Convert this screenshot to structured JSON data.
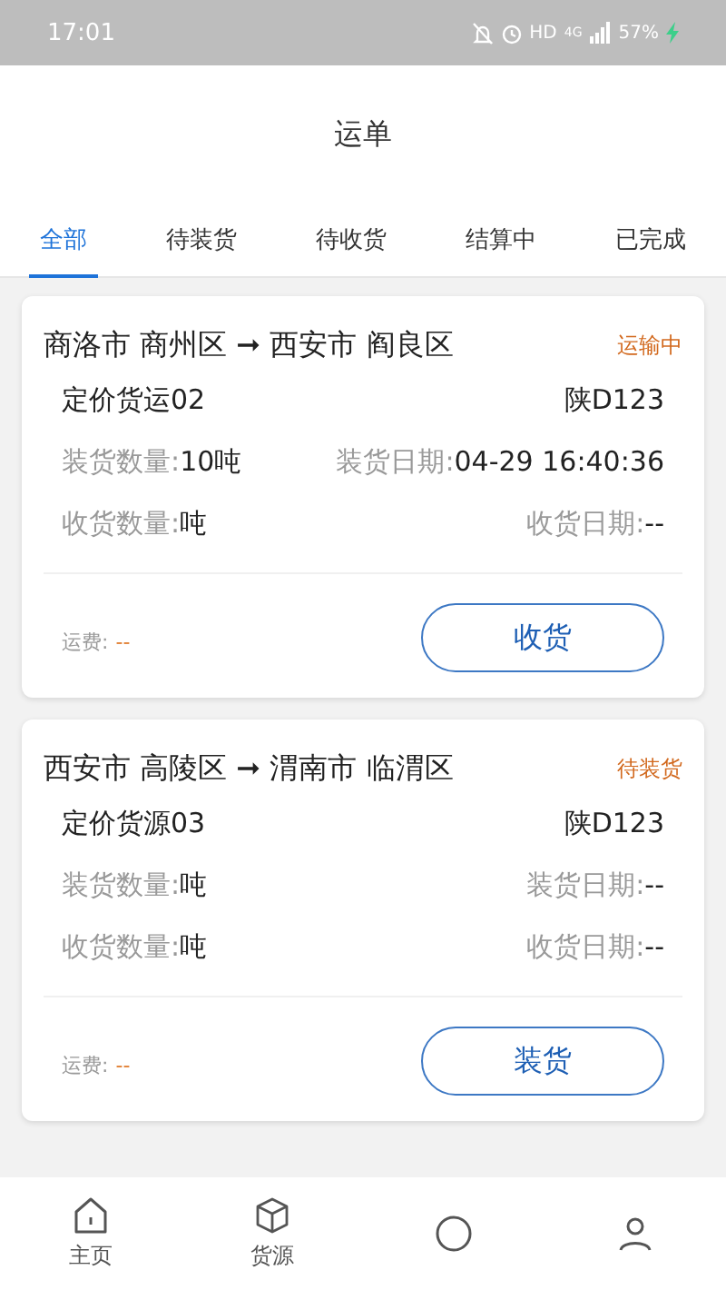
{
  "status_bar": {
    "time": "17:01",
    "hd": "HD",
    "network": "4G",
    "battery": "57%",
    "charging": true
  },
  "title": "运单",
  "tabs": [
    {
      "label": "全部",
      "selected": true
    },
    {
      "label": "待装货",
      "selected": false
    },
    {
      "label": "待收货",
      "selected": false
    },
    {
      "label": "结算中",
      "selected": false
    },
    {
      "label": "已完成",
      "selected": false
    }
  ],
  "orders": [
    {
      "route": "商洛市 商州区 ➞ 西安市 阎良区",
      "status": "运输中",
      "name": "定价货运02",
      "plate": "陕D123",
      "load_qty": {
        "label": "装货数量:",
        "value": "10吨"
      },
      "load_date": {
        "label": "装货日期:",
        "value": "04-29 16:40:36"
      },
      "recv_qty": {
        "label": "收货数量:",
        "value": "吨"
      },
      "recv_date": {
        "label": "收货日期:",
        "value": "--"
      },
      "fee": {
        "label": "运费:",
        "value": "--"
      },
      "action": "收货"
    },
    {
      "route": "西安市 高陵区 ➞ 渭南市 临渭区",
      "status": "待装货",
      "name": "定价货源03",
      "plate": "陕D123",
      "load_qty": {
        "label": "装货数量:",
        "value": "吨"
      },
      "load_date": {
        "label": "装货日期:",
        "value": "--"
      },
      "recv_qty": {
        "label": "收货数量:",
        "value": "吨"
      },
      "recv_date": {
        "label": "收货日期:",
        "value": "--"
      },
      "fee": {
        "label": "运费:",
        "value": "--"
      },
      "action": "装货"
    }
  ],
  "nav": [
    {
      "kind": "home",
      "label": "主页",
      "selected": false
    },
    {
      "kind": "box",
      "label": "货源",
      "selected": false
    },
    {
      "kind": "orders",
      "selected": false
    },
    {
      "kind": "user",
      "selected": false
    }
  ]
}
